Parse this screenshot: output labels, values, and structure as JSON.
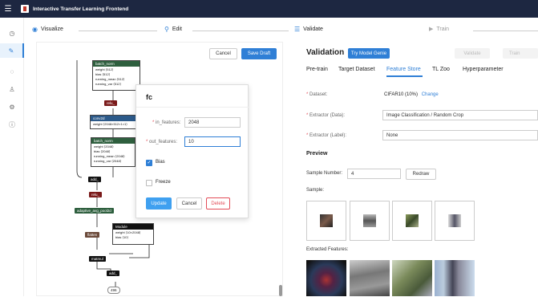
{
  "app": {
    "title": "Interactive Transfer Learning Frontend"
  },
  "steps": {
    "visualize": "Visualize",
    "edit": "Edit",
    "validate": "Validate",
    "train": "Train"
  },
  "canvas": {
    "cancel": "Cancel",
    "save_draft": "Save Draft"
  },
  "nodes": {
    "bn_top": {
      "title": "batch_norm",
      "weight": "weight ⟨512⟩",
      "bias": "bias ⟨512⟩",
      "rm": "running_mean ⟨512⟩",
      "rv": "running_var ⟨512⟩"
    },
    "relu1": "relu_",
    "conv": {
      "title": "conv2d",
      "weight": "weight ⟨2048×512×1×1⟩"
    },
    "bn2": {
      "title": "batch_norm",
      "weight": "weight ⟨2048⟩",
      "bias": "bias ⟨2048⟩",
      "rm": "running_mean ⟨2048⟩",
      "rv": "running_var ⟨2048⟩"
    },
    "add1": "add_",
    "relu2": "relu_",
    "pool": "adaptive_avg_pool2d",
    "flatten": "flatten",
    "module": {
      "title": "Module",
      "weight": "weight ⟨10×2048⟩",
      "bias": "bias ⟨10⟩"
    },
    "matmul": "matmul",
    "add2": "add_",
    "out": "496"
  },
  "fc_panel": {
    "title": "fc",
    "in_label": "in_features:",
    "in_value": "2048",
    "out_label": "out_features:",
    "out_value": "10",
    "bias_label": "Bias",
    "freeze_label": "Freeze",
    "update": "Update",
    "cancel": "Cancel",
    "delete": "Delete"
  },
  "validation": {
    "heading": "Validation",
    "try_button": "Try Model Genie",
    "validate_button": "Validate",
    "train_button": "Train",
    "tabs": [
      "Pre-train",
      "Target Dataset",
      "Feature Store",
      "TL Zoo",
      "Hyperparameter"
    ],
    "active_tab": 2,
    "dataset_label": "Dataset:",
    "dataset_value": "CIFAR10 (10%)",
    "dataset_change": "Change",
    "extractor_data_label": "Extractor (Data):",
    "extractor_data_value": "Image Classification / Random Crop",
    "extractor_label_label": "Extractor (Label):",
    "extractor_label_value": "None",
    "preview_heading": "Preview",
    "sample_number_label": "Sample Number:",
    "sample_number_value": "4",
    "redraw": "Redraw",
    "sample_label": "Sample:",
    "extracted_label": "Extracted Features:"
  },
  "colors": {
    "accent": "#2f7fd6",
    "topbar": "#1d2741",
    "danger": "#e34d59"
  }
}
